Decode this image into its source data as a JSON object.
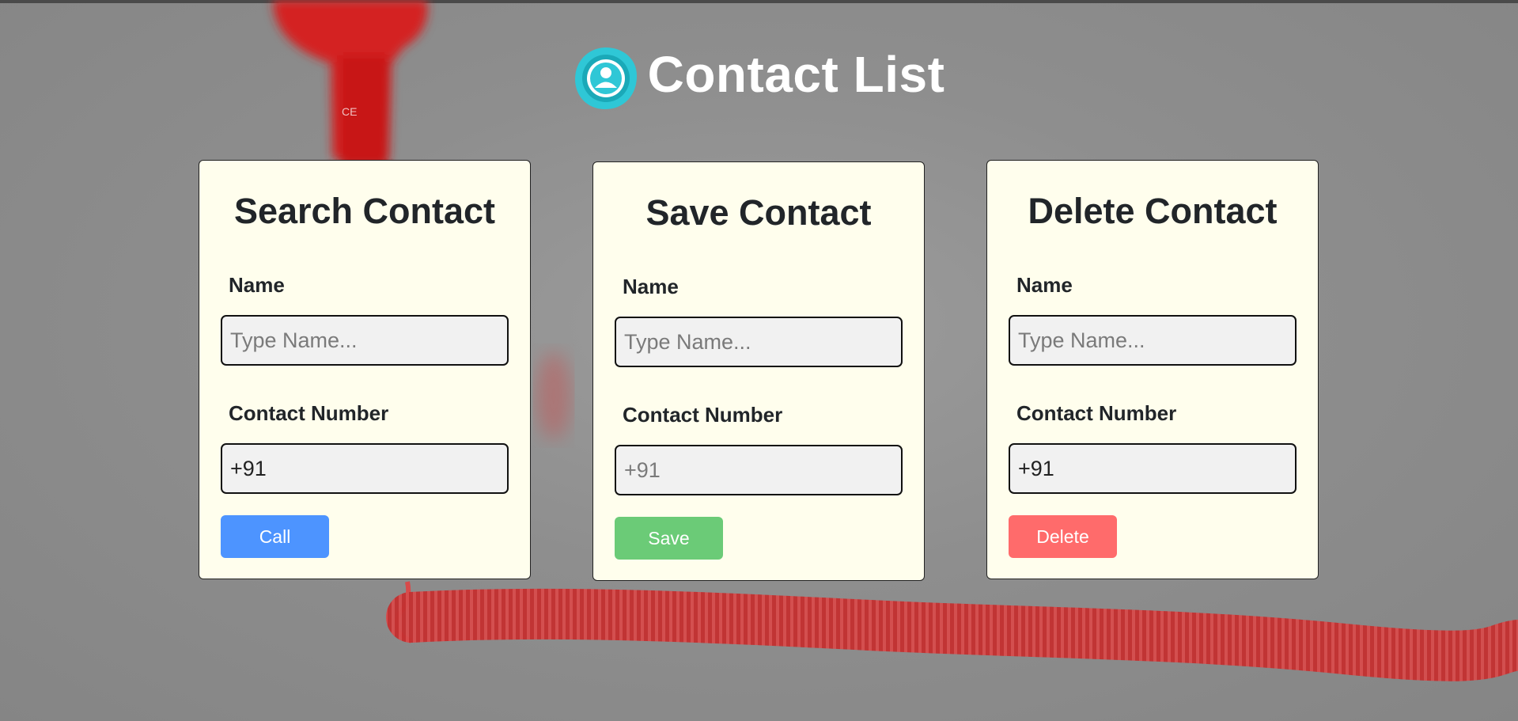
{
  "header": {
    "title": "Contact List",
    "logo_icon": "contact-user-icon",
    "accent": "#2fc7d6"
  },
  "cards": {
    "search": {
      "title": "Search Contact",
      "name_label": "Name",
      "name_placeholder": "Type Name...",
      "name_value": "",
      "number_label": "Contact Number",
      "number_placeholder": "+91",
      "number_value": "+91",
      "button_label": "Call",
      "button_color": "#4d94ff"
    },
    "save": {
      "title": "Save Contact",
      "name_label": "Name",
      "name_placeholder": "Type Name...",
      "name_value": "",
      "number_label": "Contact Number",
      "number_placeholder": "+91",
      "number_value": "",
      "button_label": "Save",
      "button_color": "#6bcb77"
    },
    "delete": {
      "title": "Delete Contact",
      "name_label": "Name",
      "name_placeholder": "Type Name...",
      "name_value": "",
      "number_label": "Contact Number",
      "number_placeholder": "+91",
      "number_value": "+91",
      "button_label": "Delete",
      "button_color": "#ff6b6b"
    }
  }
}
